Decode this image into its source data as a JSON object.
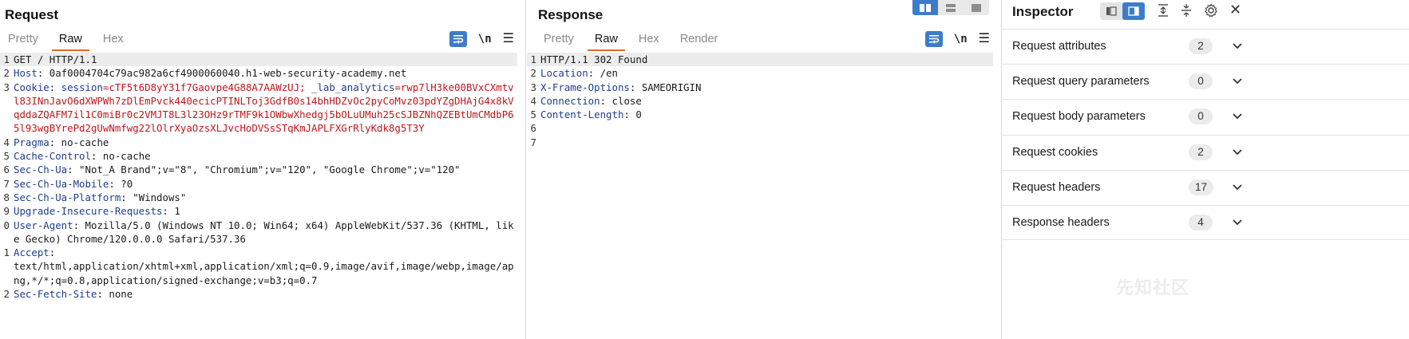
{
  "request": {
    "title": "Request",
    "tabs": [
      "Pretty",
      "Raw",
      "Hex"
    ],
    "active_tab": "Raw",
    "newline_toggle": "\\n",
    "lines": [
      {
        "n": "1",
        "parts": [
          {
            "t": "GET / HTTP/1.1",
            "c": "v"
          }
        ],
        "hl": true
      },
      {
        "n": "2",
        "parts": [
          {
            "t": "Host",
            "c": "k"
          },
          {
            "t": ": 0af0004704c79ac982a6cf4900060040.h1-web-security-academy.net",
            "c": "v"
          }
        ]
      },
      {
        "n": "3",
        "parts": [
          {
            "t": "Cookie",
            "c": "k"
          },
          {
            "t": ": ",
            "c": "v"
          },
          {
            "t": "session",
            "c": "k"
          },
          {
            "t": "=cTF5t6D8yY31f7Gaovpe4G88A7AAWzUJ; ",
            "c": "r"
          },
          {
            "t": "_lab_analytics",
            "c": "k"
          },
          {
            "t": "=rwp7lH3ke00BVxCXmtvl83INnJavO6dXWPWh7zDlEmPvck440ecicPTINLToj3GdfB0s14bhHDZvOc2pyCoMvz03pdYZgDHAjG4x8kVqddaZQAFM7il1C0miBr0c2VMJT8L3l23OHz9rTMF9k1OWbwXhedgj5bOLuUMuh25cSJBZNhQZEBtUmCMdbP65l93wgBYrePd2gUwNmfwg22lOlrXyaOzsXLJvcHoDVSsSTqKmJAPLFXGrRlyKdk8g5T3Y",
            "c": "r"
          }
        ]
      },
      {
        "n": "4",
        "parts": [
          {
            "t": "Pragma",
            "c": "k"
          },
          {
            "t": ": no-cache",
            "c": "v"
          }
        ]
      },
      {
        "n": "5",
        "parts": [
          {
            "t": "Cache-Control",
            "c": "k"
          },
          {
            "t": ": no-cache",
            "c": "v"
          }
        ]
      },
      {
        "n": "6",
        "parts": [
          {
            "t": "Sec-Ch-Ua",
            "c": "k"
          },
          {
            "t": ": \"Not_A Brand\";v=\"8\", \"Chromium\";v=\"120\", \"Google Chrome\";v=\"120\"",
            "c": "v"
          }
        ]
      },
      {
        "n": "7",
        "parts": [
          {
            "t": "Sec-Ch-Ua-Mobile",
            "c": "k"
          },
          {
            "t": ": ?0",
            "c": "v"
          }
        ]
      },
      {
        "n": "8",
        "parts": [
          {
            "t": "Sec-Ch-Ua-Platform",
            "c": "k"
          },
          {
            "t": ": \"Windows\"",
            "c": "v"
          }
        ]
      },
      {
        "n": "9",
        "parts": [
          {
            "t": "Upgrade-Insecure-Requests",
            "c": "k"
          },
          {
            "t": ": 1",
            "c": "v"
          }
        ]
      },
      {
        "n": "0",
        "parts": [
          {
            "t": "User-Agent",
            "c": "k"
          },
          {
            "t": ": Mozilla/5.0 (Windows NT 10.0; Win64; x64) AppleWebKit/537.36 (KHTML, like Gecko) Chrome/120.0.0.0 Safari/537.36",
            "c": "v"
          }
        ]
      },
      {
        "n": "1",
        "parts": [
          {
            "t": "Accept",
            "c": "k"
          },
          {
            "t": ":\ntext/html,application/xhtml+xml,application/xml;q=0.9,image/avif,image/webp,image/apng,*/*;q=0.8,application/signed-exchange;v=b3;q=0.7",
            "c": "v"
          }
        ]
      },
      {
        "n": "2",
        "parts": [
          {
            "t": "Sec-Fetch-Site",
            "c": "k"
          },
          {
            "t": ": none",
            "c": "v"
          }
        ]
      }
    ]
  },
  "response": {
    "title": "Response",
    "tabs": [
      "Pretty",
      "Raw",
      "Hex",
      "Render"
    ],
    "active_tab": "Raw",
    "newline_toggle": "\\n",
    "lines": [
      {
        "n": "1",
        "parts": [
          {
            "t": "HTTP/1.1 302 Found",
            "c": "v"
          }
        ],
        "hl": true
      },
      {
        "n": "2",
        "parts": [
          {
            "t": "Location",
            "c": "k"
          },
          {
            "t": ": /en",
            "c": "v"
          }
        ]
      },
      {
        "n": "3",
        "parts": [
          {
            "t": "X-Frame-Options",
            "c": "k"
          },
          {
            "t": ": SAMEORIGIN",
            "c": "v"
          }
        ]
      },
      {
        "n": "4",
        "parts": [
          {
            "t": "Connection",
            "c": "k"
          },
          {
            "t": ": close",
            "c": "v"
          }
        ]
      },
      {
        "n": "5",
        "parts": [
          {
            "t": "Content-Length",
            "c": "k"
          },
          {
            "t": ": 0",
            "c": "v"
          }
        ]
      },
      {
        "n": "6",
        "parts": [
          {
            "t": "",
            "c": "v"
          }
        ]
      },
      {
        "n": "7",
        "parts": [
          {
            "t": "",
            "c": "v"
          }
        ]
      }
    ]
  },
  "inspector": {
    "title": "Inspector",
    "sections": [
      {
        "label": "Request attributes",
        "count": "2"
      },
      {
        "label": "Request query parameters",
        "count": "0"
      },
      {
        "label": "Request body parameters",
        "count": "0"
      },
      {
        "label": "Request cookies",
        "count": "2"
      },
      {
        "label": "Request headers",
        "count": "17"
      },
      {
        "label": "Response headers",
        "count": "4"
      }
    ]
  },
  "watermark": "先知社区",
  "colors": {
    "accent": "#3d7cc9",
    "tab_underline": "#e8672b",
    "header_key": "#1f3e8a",
    "cookie_value": "#c0161c"
  }
}
